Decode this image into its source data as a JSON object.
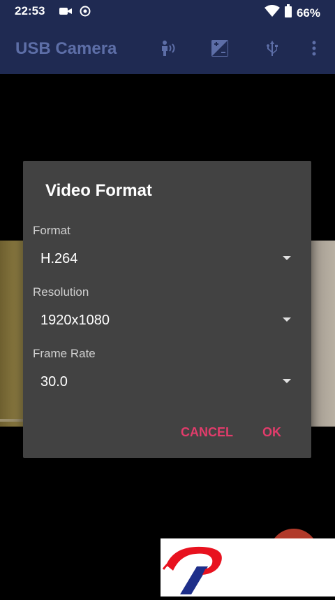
{
  "status_bar": {
    "time": "22:53",
    "battery": "66%"
  },
  "app_bar": {
    "title": "USB Camera",
    "icons": [
      "person-voice-icon",
      "exposure-icon",
      "usb-icon",
      "more-vert-icon"
    ]
  },
  "dialog": {
    "title": "Video Format",
    "fields": [
      {
        "label": "Format",
        "value": "H.264"
      },
      {
        "label": "Resolution",
        "value": "1920x1080"
      },
      {
        "label": "Frame Rate",
        "value": "30.0"
      }
    ],
    "cancel_label": "CANCEL",
    "ok_label": "OK"
  },
  "colors": {
    "app_bar": "#1f2a52",
    "dialog_bg": "#424242",
    "accent": "#e23c6b"
  }
}
